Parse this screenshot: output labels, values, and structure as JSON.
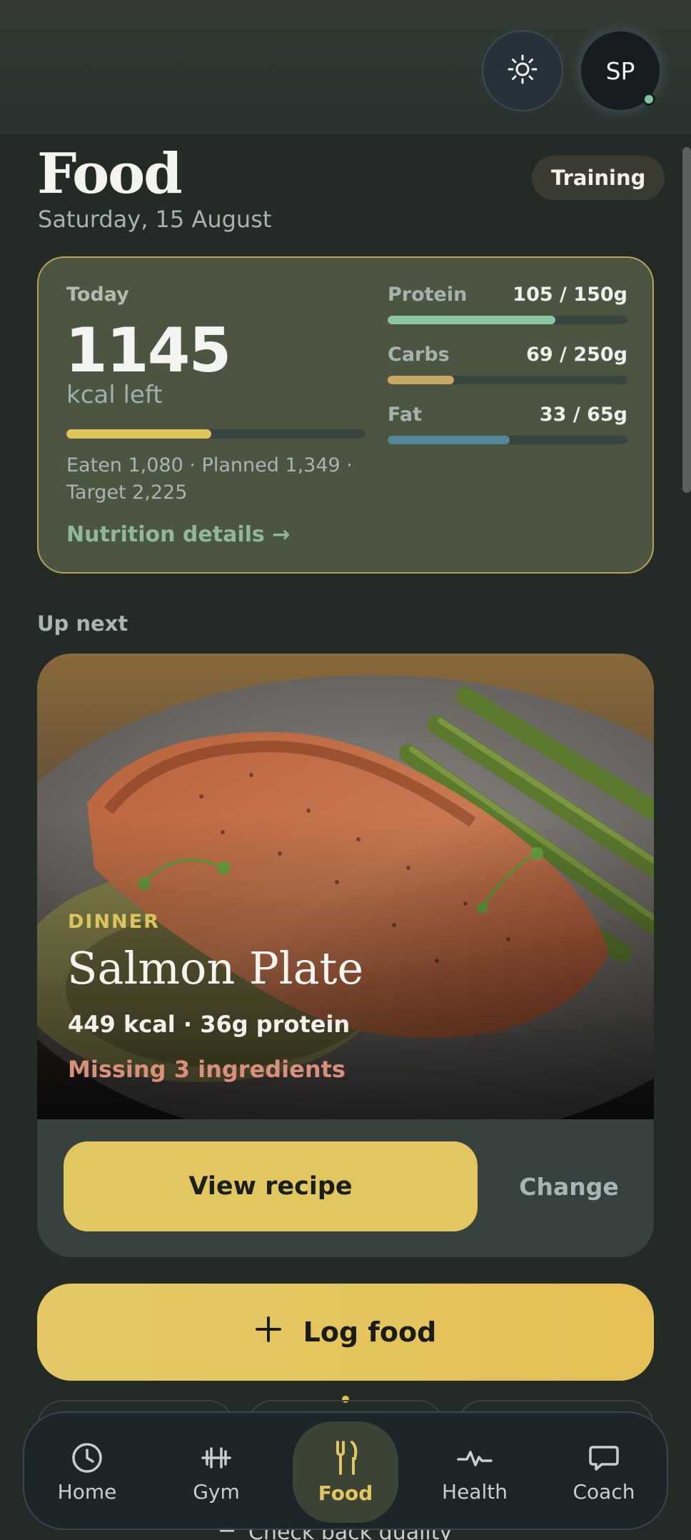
{
  "header": {
    "theme_icon": "sun-icon",
    "avatar_initials": "SP"
  },
  "page": {
    "title": "Food",
    "date": "Saturday, 15 August",
    "mode_chip": "Training"
  },
  "summary": {
    "label": "Today",
    "kcal_left": "1145",
    "kcal_unit": "kcal left",
    "calorie_progress": 0.485,
    "breakdown": "Eaten 1,080 · Planned 1,349 · Target 2,225",
    "link": "Nutrition details →",
    "macros": [
      {
        "name": "Protein",
        "value": "105 / 150g",
        "progress": 0.7,
        "color": "#8cc3a2"
      },
      {
        "name": "Carbs",
        "value": "69 / 250g",
        "progress": 0.276,
        "color": "#c9a765"
      },
      {
        "name": "Fat",
        "value": "33 / 65g",
        "progress": 0.508,
        "color": "#55879c"
      }
    ]
  },
  "up_next": {
    "section_label": "Up next",
    "meal_type": "DINNER",
    "meal_name": "Salmon Plate",
    "meal_meta": "449 kcal · 36g protein",
    "missing": "Missing 3 ingredients",
    "primary_action": "View recipe",
    "secondary_action": "Change"
  },
  "log_button": {
    "label": "Log food",
    "icon": "plus-icon"
  },
  "behind_nav_text": "Check back quality",
  "bottom_nav": {
    "items": [
      {
        "label": "Home",
        "icon": "clock-icon"
      },
      {
        "label": "Gym",
        "icon": "dumbbell-icon"
      },
      {
        "label": "Food",
        "icon": "utensils-icon",
        "active": true
      },
      {
        "label": "Health",
        "icon": "pulse-icon"
      },
      {
        "label": "Coach",
        "icon": "chat-icon"
      }
    ]
  },
  "colors": {
    "background": "#242a26",
    "accent": "#e2c660",
    "card": "#4c5542",
    "card_border": "#b2a45a",
    "warning": "#d79079",
    "success": "#8fb89a"
  }
}
